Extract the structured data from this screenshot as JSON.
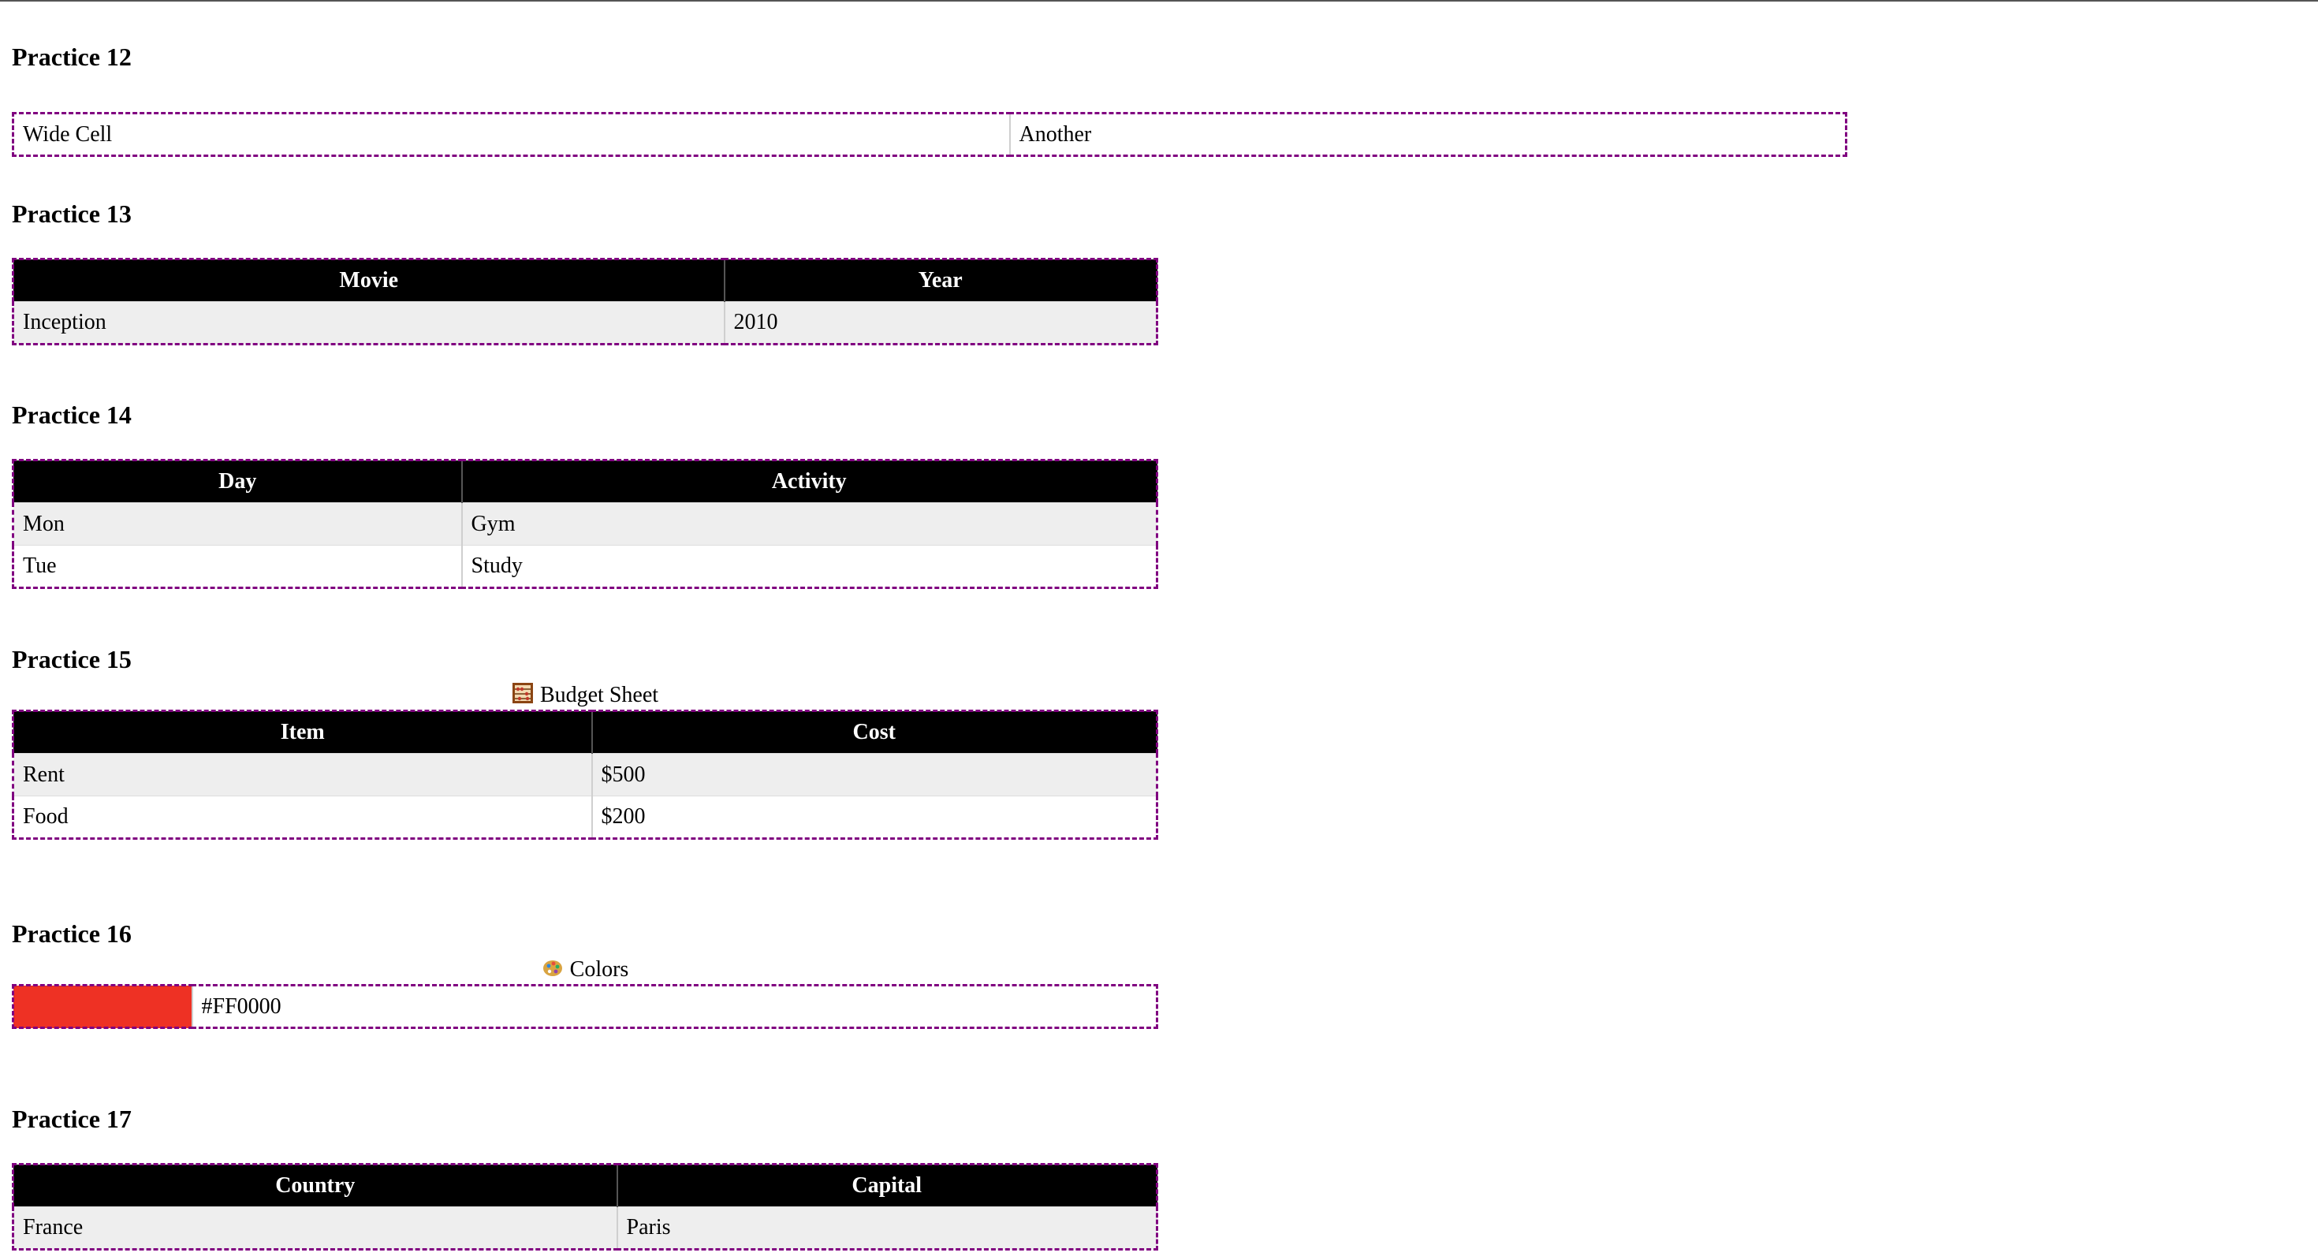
{
  "practice12": {
    "heading": "Practice 12",
    "cells": [
      "Wide Cell",
      "Another"
    ]
  },
  "practice13": {
    "heading": "Practice 13",
    "headers": [
      "Movie",
      "Year"
    ],
    "rows": [
      [
        "Inception",
        "2010"
      ]
    ]
  },
  "practice14": {
    "heading": "Practice 14",
    "headers": [
      "Day",
      "Activity"
    ],
    "rows": [
      [
        "Mon",
        "Gym"
      ],
      [
        "Tue",
        "Study"
      ]
    ]
  },
  "practice15": {
    "heading": "Practice 15",
    "caption": "Budget Sheet",
    "caption_icon": "abacus-icon",
    "headers": [
      "Item",
      "Cost"
    ],
    "rows": [
      [
        "Rent",
        "$500"
      ],
      [
        "Food",
        "$200"
      ]
    ]
  },
  "practice16": {
    "heading": "Practice 16",
    "caption": "Colors",
    "caption_icon": "palette-icon",
    "swatch_color": "#FF0000",
    "swatch_label": "#FF0000"
  },
  "practice17": {
    "heading": "Practice 17",
    "headers": [
      "Country",
      "Capital"
    ],
    "rows": [
      [
        "France",
        "Paris"
      ]
    ]
  },
  "colors": {
    "header_bg": "#000000",
    "table_border": "#800080",
    "stripe_bg": "#eeeeee"
  }
}
